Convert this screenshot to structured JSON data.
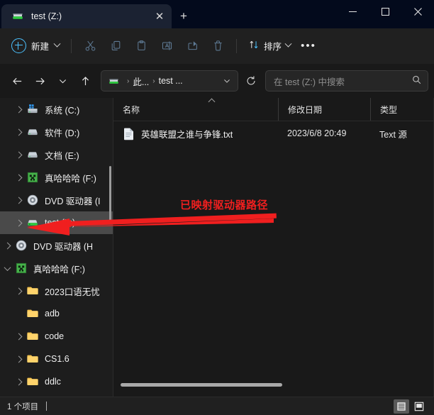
{
  "window": {
    "tab": {
      "title": "test (Z:)",
      "icon": "network-drive-icon",
      "close": "✕"
    },
    "new_tab_label": "+",
    "controls": {
      "minimize": "minimize-icon",
      "maximize": "maximize-icon",
      "close": "close-icon"
    }
  },
  "toolbar": {
    "new_label": "新建",
    "sort_label": "排序",
    "more_label": "•••",
    "icons": [
      "cut-icon",
      "copy-icon",
      "paste-icon",
      "rename-icon",
      "share-icon",
      "delete-icon"
    ]
  },
  "address": {
    "back": "back-arrow-icon",
    "forward": "forward-arrow-icon",
    "recent": "chevron-down-icon",
    "up": "up-arrow-icon",
    "breadcrumb_icon": "network-drive-icon",
    "crumbs": [
      "此...",
      "test ..."
    ],
    "separator": "›",
    "refresh": "refresh-icon",
    "search_placeholder": "在 test (Z:) 中搜索",
    "search_value": ""
  },
  "sidebar": {
    "items": [
      {
        "label": "系统 (C:)",
        "icon": "windows-drive-icon",
        "chevron": "collapsed",
        "indent": 1,
        "selected": false
      },
      {
        "label": "软件 (D:)",
        "icon": "drive-icon",
        "chevron": "collapsed",
        "indent": 1,
        "selected": false
      },
      {
        "label": "文档 (E:)",
        "icon": "drive-icon",
        "chevron": "collapsed",
        "indent": 1,
        "selected": false
      },
      {
        "label": "真哈哈哈 (F:)",
        "icon": "creeper-drive-icon",
        "chevron": "collapsed",
        "indent": 1,
        "selected": false
      },
      {
        "label": "DVD 驱动器 (I",
        "icon": "disc-icon",
        "chevron": "collapsed",
        "indent": 1,
        "selected": false
      },
      {
        "label": "test (Z:)",
        "icon": "network-drive-icon",
        "chevron": "collapsed",
        "indent": 1,
        "selected": true
      },
      {
        "label": "DVD 驱动器 (H",
        "icon": "disc-icon",
        "chevron": "collapsed",
        "indent": 0,
        "selected": false
      },
      {
        "label": "真哈哈哈 (F:)",
        "icon": "creeper-drive-icon",
        "chevron": "expanded",
        "indent": 0,
        "selected": false
      },
      {
        "label": "2023口语无忧",
        "icon": "folder-icon",
        "chevron": "collapsed",
        "indent": 1,
        "selected": false
      },
      {
        "label": "adb",
        "icon": "folder-icon",
        "chevron": "none",
        "indent": 1,
        "selected": false
      },
      {
        "label": "code",
        "icon": "folder-icon",
        "chevron": "collapsed",
        "indent": 1,
        "selected": false
      },
      {
        "label": "CS1.6",
        "icon": "folder-icon",
        "chevron": "collapsed",
        "indent": 1,
        "selected": false
      },
      {
        "label": "ddlc",
        "icon": "folder-icon",
        "chevron": "collapsed",
        "indent": 1,
        "selected": false
      }
    ]
  },
  "filelist": {
    "columns": [
      "名称",
      "修改日期",
      "类型"
    ],
    "sort_column": "名称",
    "sort_direction": "ascending",
    "rows": [
      {
        "name": "英雄联盟之谁与争锋.txt",
        "date": "2023/6/8 20:49",
        "type": "Text 源",
        "icon": "text-file-icon"
      }
    ]
  },
  "annotation": {
    "text": "已映射驱动器路径",
    "color": "#f01f1f"
  },
  "statusbar": {
    "count_label": "1 个项目",
    "view_list": "list-view-icon",
    "view_details": "details-view-icon"
  },
  "colors": {
    "titlebar": "#030a1c",
    "tab_active": "#1b2232",
    "toolbar": "#202020",
    "sidebar": "#1d1d1d",
    "content": "#191919",
    "selection": "#4a4a4a",
    "accent": "#4cc2ff",
    "annotation": "#f01f1f"
  }
}
